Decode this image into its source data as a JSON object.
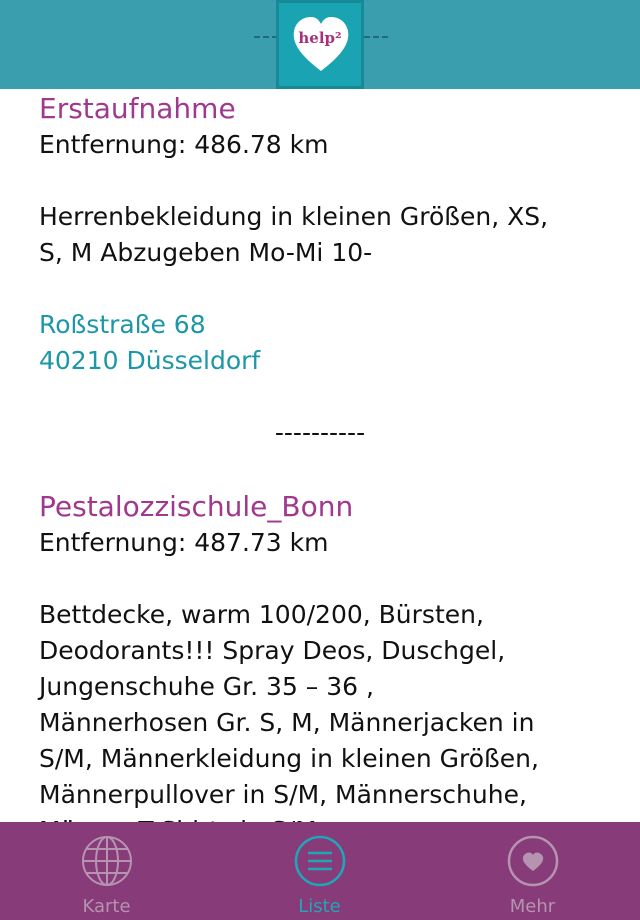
{
  "header": {
    "logo_text": "help²"
  },
  "entries": [
    {
      "title": "Erstaufnahme",
      "distance": "Entfernung: 486.78 km",
      "description_lines": [
        "Herrenbekleidung in kleinen Größen, XS,",
        "S, M Abzugeben Mo-Mi 10-"
      ],
      "address_line1": "Roßstraße 68",
      "address_line2": "40210 Düsseldorf"
    },
    {
      "title": "Pestalozzischule_Bonn",
      "distance": "Entfernung: 487.73 km",
      "description_lines": [
        "Bettdecke, warm 100/200, Bürsten,",
        "Deodorants!!! Spray Deos, Duschgel,",
        "Jungenschuhe Gr. 35 – 36 ,",
        "Männerhosen Gr. S, M, Männerjacken in",
        "S/M, Männerkleidung in kleinen Größen,",
        "Männerpullover in S/M, Männerschuhe,",
        "Männer-T-Shirts in S/M,"
      ]
    }
  ],
  "separator": "----------",
  "tabs": [
    {
      "label": "Karte",
      "icon": "globe-icon",
      "active": false
    },
    {
      "label": "Liste",
      "icon": "list-icon",
      "active": true
    },
    {
      "label": "Mehr",
      "icon": "heart-icon",
      "active": false
    }
  ],
  "colors": {
    "header_bg": "#3a9eae",
    "title": "#a0398e",
    "address": "#1b97a8",
    "tabbar_bg": "#873b79",
    "tab_active": "#1fa7b8",
    "tab_inactive": "#b693b0"
  }
}
